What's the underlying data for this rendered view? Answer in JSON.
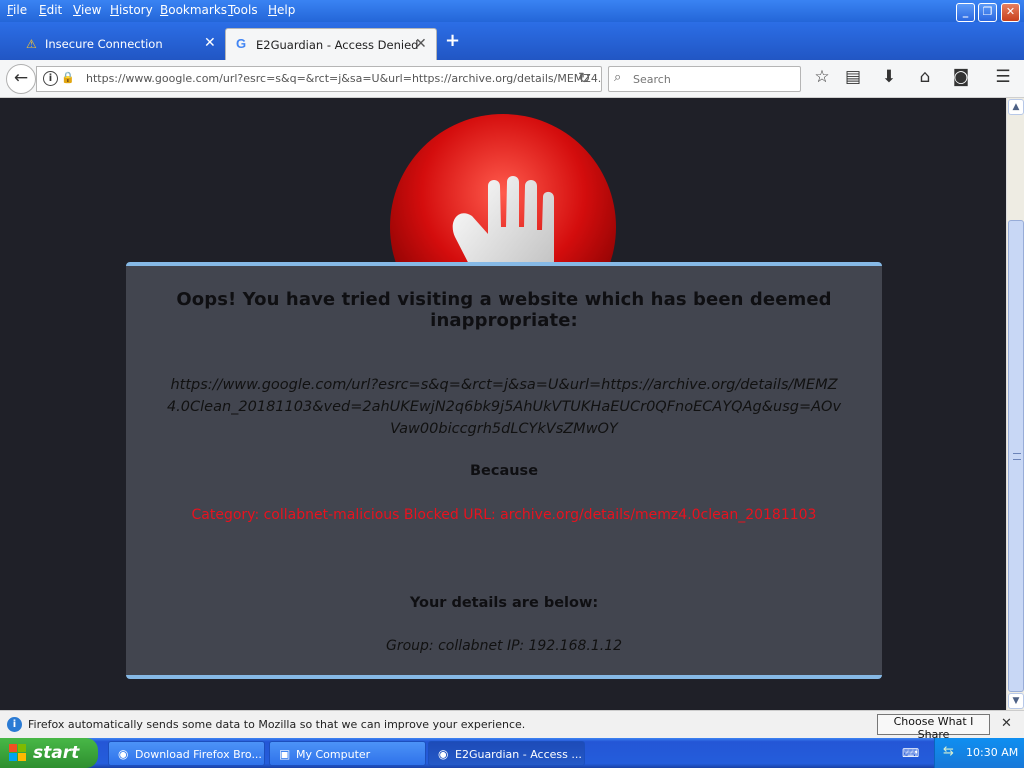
{
  "menu": [
    "File",
    "Edit",
    "View",
    "History",
    "Bookmarks",
    "Tools",
    "Help"
  ],
  "tabs": [
    {
      "title": "Insecure Connection",
      "icon": "warning-icon"
    },
    {
      "title": "E2Guardian - Access Denied",
      "icon": "google-icon",
      "favicon_letter": "G"
    }
  ],
  "nav": {
    "url": "https://www.google.com/url?esrc=s&q=&rct=j&sa=U&url=https://archive.org/details/MEMZ4.",
    "search_placeholder": "Search"
  },
  "page": {
    "heading": "Oops! You have tried visiting a website which has been deemed inappropriate:",
    "blocked_url": "https://www.google.com/url?esrc=s&q=&rct=j&sa=U&url=https://archive.org/details/MEMZ4.0Clean_20181103&ved=2ahUKEwjN2q6bk9j5AhUkVTUKHaEUCr0QFnoECAYQAg&usg=AOvVaw00biccgrh5dLCYkVsZMwOY",
    "because_label": "Because",
    "reason": "Category: collabnet-malicious   Blocked URL: archive.org/details/memz4.0clean_20181103",
    "details_label": "Your details are below:",
    "identity": "Group: collabnet   IP: 192.168.1.12"
  },
  "notification": {
    "message": "Firefox automatically sends some data to Mozilla so that we can improve your experience.",
    "button": "Choose What I Share"
  },
  "taskbar": {
    "start": "start",
    "tasks": [
      {
        "label": "Download Firefox Bro...",
        "icon": "firefox-icon"
      },
      {
        "label": "My Computer",
        "icon": "computer-icon"
      },
      {
        "label": "E2Guardian - Access ...",
        "icon": "firefox-icon"
      }
    ],
    "clock": "10:30 AM"
  },
  "colors": {
    "page_bg": "#1f2028",
    "panel_bg": "#42454f",
    "panel_border": "#86b9e6",
    "reason_red": "#e8121e",
    "xp_blue": "#2456d6"
  }
}
